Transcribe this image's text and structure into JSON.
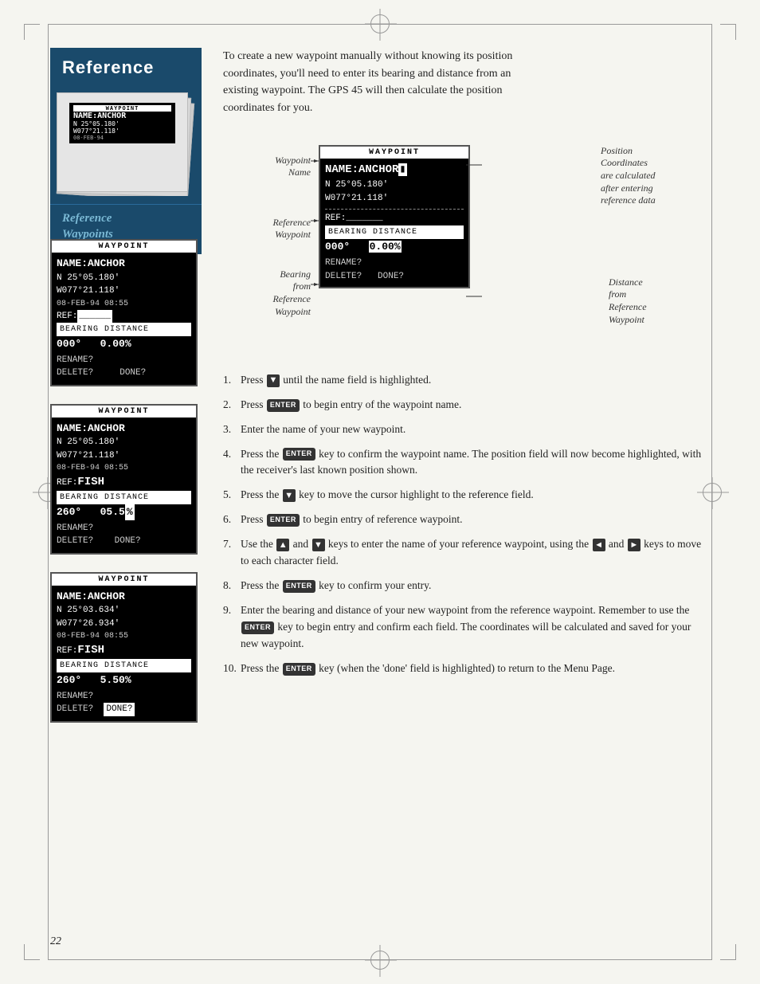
{
  "page": {
    "number": "22",
    "background": "#f5f5f0"
  },
  "sidebar": {
    "title": "Reference",
    "subtitle": "Reference\nWaypoints"
  },
  "intro": {
    "text": "To create a new waypoint manually without knowing its position coordinates, you'll need to enter its bearing and distance from an existing waypoint. The GPS 45 will then calculate the position coordinates for you."
  },
  "diagram": {
    "screen_title": "WAYPOINT",
    "name_line": "NAME:ANCHOR",
    "coord1": "N 25°05.180'",
    "coord2": "W077°21.118'",
    "ref_line": "REF:_______",
    "bearing_header": "BEARING DISTANCE",
    "bearing_values": "000°    0.00%",
    "rename": "RENAME?",
    "delete": "DELETE?",
    "done": "DONE?",
    "annotations": {
      "waypoint_name": "Waypoint\nName",
      "reference_waypoint": "Reference\nWaypoint",
      "bearing_from": "Bearing\nfrom\nReference\nWaypoint",
      "position_coords": "Position\nCoordinates\nare calculated\nafter entering\nreference data",
      "distance_from": "Distance\nfrom\nReference\nWaypoint"
    }
  },
  "screens": [
    {
      "id": "screen1",
      "title": "WAYPOINT",
      "name": "NAME:ANCHOR",
      "coord1": "N  25°05.180'",
      "coord2": "W077°21.118'",
      "date": "08-FEB-94 08:55",
      "ref": "REF:",
      "ref_suffix": "______",
      "bearing_header": "BEARING DISTANCE",
      "bearing": "000°",
      "distance": "0.00%",
      "rename": "RENAME?",
      "delete": "DELETE?",
      "done": ""
    },
    {
      "id": "screen2",
      "title": "WAYPOINT",
      "name": "NAME:ANCHOR",
      "coord1": "N  25°05.180'",
      "coord2": "W077°21.118'",
      "date": "08-FEB-94 08:55",
      "ref": "REF:FISH",
      "bearing_header": "BEARING DISTANCE",
      "bearing": "260°",
      "distance": "05.5%",
      "rename": "RENAME?",
      "delete": "DELETE?",
      "done": "DONE?"
    },
    {
      "id": "screen3",
      "title": "WAYPOINT",
      "name": "NAME:ANCHOR",
      "coord1": "N  25°03.634'",
      "coord2": "W077°26.934'",
      "date": "08-FEB-94 08:55",
      "ref": "REF:FISH",
      "bearing_header": "BEARING DISTANCE",
      "bearing": "260°",
      "distance": "5.50%",
      "rename": "RENAME?",
      "delete": "DELETE?",
      "done": "DONE?"
    }
  ],
  "instructions": [
    {
      "num": "1.",
      "text": "Press ▼ until the name field is highlighted."
    },
    {
      "num": "2.",
      "text": "Press [ENTER] to begin entry of the waypoint name."
    },
    {
      "num": "3.",
      "text": "Enter the name of your new waypoint."
    },
    {
      "num": "4.",
      "text": "Press the [ENTER] key to confirm the waypoint name. The position field will now become highlighted, with the receiver's last known position shown."
    },
    {
      "num": "5.",
      "text": "Press the ▼ key to move the cursor highlight to the reference field."
    },
    {
      "num": "6.",
      "text": "Press [ENTER] to begin entry of reference waypoint."
    },
    {
      "num": "7.",
      "text": "Use the ▲ and ▼ keys to enter the name of your reference waypoint, using the ◄ and ► keys to move to each character field."
    },
    {
      "num": "8.",
      "text": "Press the [ENTER] key to confirm your entry."
    },
    {
      "num": "9.",
      "text": "Enter the bearing and distance of your new waypoint from the reference waypoint. Remember to use the [ENTER] key to begin entry and confirm each field. The coordinates will be calculated and saved for your new waypoint."
    },
    {
      "num": "10.",
      "text": "Press the [ENTER] key (when the 'done' field is highlighted) to return to the Menu Page."
    }
  ]
}
